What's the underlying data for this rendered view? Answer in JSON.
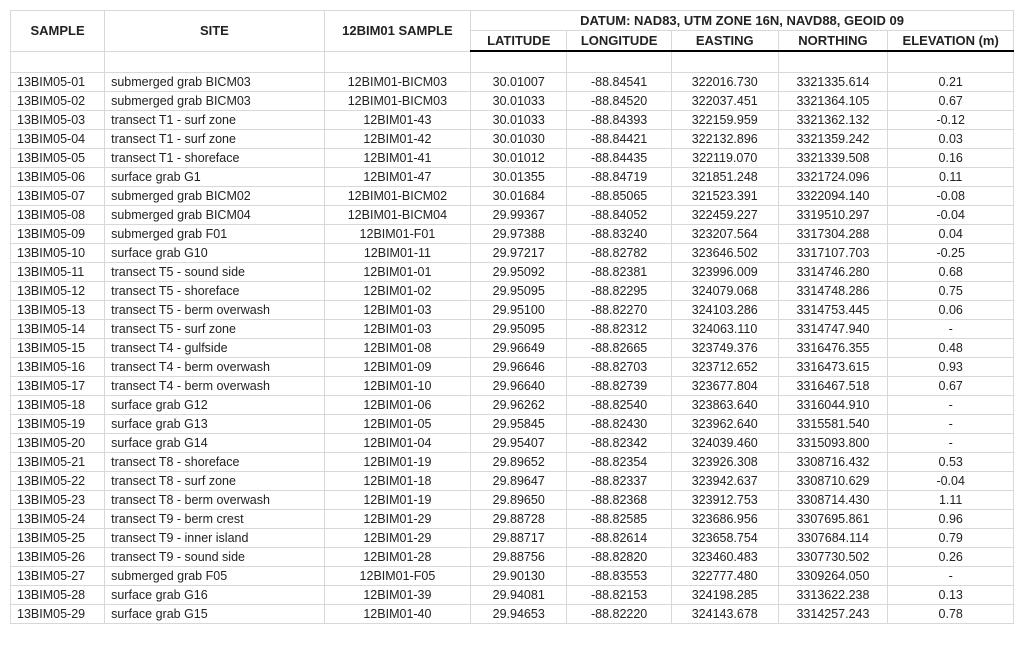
{
  "header": {
    "sample": "SAMPLE",
    "site": "SITE",
    "bim": "12BIM01 SAMPLE",
    "datum_label": "DATUM: NAD83, UTM ZONE 16N, NAVD88, GEOID 09",
    "lat": "LATITUDE",
    "lon": "LONGITUDE",
    "east": "EASTING",
    "north": "NORTHING",
    "elev": "ELEVATION (m)"
  },
  "rows": [
    {
      "sample": "13BIM05-01",
      "site": "submerged grab BICM03",
      "bim": "12BIM01-BICM03",
      "lat": "30.01007",
      "lon": "-88.84541",
      "east": "322016.730",
      "north": "3321335.614",
      "elev": "0.21"
    },
    {
      "sample": "13BIM05-02",
      "site": "submerged grab BICM03",
      "bim": "12BIM01-BICM03",
      "lat": "30.01033",
      "lon": "-88.84520",
      "east": "322037.451",
      "north": "3321364.105",
      "elev": "0.67"
    },
    {
      "sample": "13BIM05-03",
      "site": "transect T1 - surf zone",
      "bim": "12BIM01-43",
      "lat": "30.01033",
      "lon": "-88.84393",
      "east": "322159.959",
      "north": "3321362.132",
      "elev": "-0.12"
    },
    {
      "sample": "13BIM05-04",
      "site": "transect T1 - surf zone",
      "bim": "12BIM01-42",
      "lat": "30.01030",
      "lon": "-88.84421",
      "east": "322132.896",
      "north": "3321359.242",
      "elev": "0.03"
    },
    {
      "sample": "13BIM05-05",
      "site": "transect T1 - shoreface",
      "bim": "12BIM01-41",
      "lat": "30.01012",
      "lon": "-88.84435",
      "east": "322119.070",
      "north": "3321339.508",
      "elev": "0.16"
    },
    {
      "sample": "13BIM05-06",
      "site": "surface grab G1",
      "bim": "12BIM01-47",
      "lat": "30.01355",
      "lon": "-88.84719",
      "east": "321851.248",
      "north": "3321724.096",
      "elev": "0.11"
    },
    {
      "sample": "13BIM05-07",
      "site": "submerged grab BICM02",
      "bim": "12BIM01-BICM02",
      "lat": "30.01684",
      "lon": "-88.85065",
      "east": "321523.391",
      "north": "3322094.140",
      "elev": "-0.08"
    },
    {
      "sample": "13BIM05-08",
      "site": "submerged grab BICM04",
      "bim": "12BIM01-BICM04",
      "lat": "29.99367",
      "lon": "-88.84052",
      "east": "322459.227",
      "north": "3319510.297",
      "elev": "-0.04"
    },
    {
      "sample": "13BIM05-09",
      "site": "submerged grab F01",
      "bim": "12BIM01-F01",
      "lat": "29.97388",
      "lon": "-88.83240",
      "east": "323207.564",
      "north": "3317304.288",
      "elev": "0.04"
    },
    {
      "sample": "13BIM05-10",
      "site": "surface grab G10",
      "bim": "12BIM01-11",
      "lat": "29.97217",
      "lon": "-88.82782",
      "east": "323646.502",
      "north": "3317107.703",
      "elev": "-0.25"
    },
    {
      "sample": "13BIM05-11",
      "site": "transect T5 - sound side",
      "bim": "12BIM01-01",
      "lat": "29.95092",
      "lon": "-88.82381",
      "east": "323996.009",
      "north": "3314746.280",
      "elev": "0.68"
    },
    {
      "sample": "13BIM05-12",
      "site": "transect T5 - shoreface",
      "bim": "12BIM01-02",
      "lat": "29.95095",
      "lon": "-88.82295",
      "east": "324079.068",
      "north": "3314748.286",
      "elev": "0.75"
    },
    {
      "sample": "13BIM05-13",
      "site": "transect T5 - berm overwash",
      "bim": "12BIM01-03",
      "lat": "29.95100",
      "lon": "-88.82270",
      "east": "324103.286",
      "north": "3314753.445",
      "elev": "0.06"
    },
    {
      "sample": "13BIM05-14",
      "site": "transect T5 - surf zone",
      "bim": "12BIM01-03",
      "lat": "29.95095",
      "lon": "-88.82312",
      "east": "324063.110",
      "north": "3314747.940",
      "elev": "-"
    },
    {
      "sample": "13BIM05-15",
      "site": "transect T4 - gulfside",
      "bim": "12BIM01-08",
      "lat": "29.96649",
      "lon": "-88.82665",
      "east": "323749.376",
      "north": "3316476.355",
      "elev": "0.48"
    },
    {
      "sample": "13BIM05-16",
      "site": "transect T4 - berm overwash",
      "bim": "12BIM01-09",
      "lat": "29.96646",
      "lon": "-88.82703",
      "east": "323712.652",
      "north": "3316473.615",
      "elev": "0.93"
    },
    {
      "sample": "13BIM05-17",
      "site": "transect T4 - berm overwash",
      "bim": "12BIM01-10",
      "lat": "29.96640",
      "lon": "-88.82739",
      "east": "323677.804",
      "north": "3316467.518",
      "elev": "0.67"
    },
    {
      "sample": "13BIM05-18",
      "site": "surface grab G12",
      "bim": "12BIM01-06",
      "lat": "29.96262",
      "lon": "-88.82540",
      "east": "323863.640",
      "north": "3316044.910",
      "elev": "-"
    },
    {
      "sample": "13BIM05-19",
      "site": "surface grab G13",
      "bim": "12BIM01-05",
      "lat": "29.95845",
      "lon": "-88.82430",
      "east": "323962.640",
      "north": "3315581.540",
      "elev": "-"
    },
    {
      "sample": "13BIM05-20",
      "site": "surface grab G14",
      "bim": "12BIM01-04",
      "lat": "29.95407",
      "lon": "-88.82342",
      "east": "324039.460",
      "north": "3315093.800",
      "elev": "-"
    },
    {
      "sample": "13BIM05-21",
      "site": "transect T8 - shoreface",
      "bim": "12BIM01-19",
      "lat": "29.89652",
      "lon": "-88.82354",
      "east": "323926.308",
      "north": "3308716.432",
      "elev": "0.53"
    },
    {
      "sample": "13BIM05-22",
      "site": "transect T8 - surf zone",
      "bim": "12BIM01-18",
      "lat": "29.89647",
      "lon": "-88.82337",
      "east": "323942.637",
      "north": "3308710.629",
      "elev": "-0.04"
    },
    {
      "sample": "13BIM05-23",
      "site": "transect T8 - berm overwash",
      "bim": "12BIM01-19",
      "lat": "29.89650",
      "lon": "-88.82368",
      "east": "323912.753",
      "north": "3308714.430",
      "elev": "1.11"
    },
    {
      "sample": "13BIM05-24",
      "site": "transect T9 - berm crest",
      "bim": "12BIM01-29",
      "lat": "29.88728",
      "lon": "-88.82585",
      "east": "323686.956",
      "north": "3307695.861",
      "elev": "0.96"
    },
    {
      "sample": "13BIM05-25",
      "site": "transect T9 - inner island",
      "bim": "12BIM01-29",
      "lat": "29.88717",
      "lon": "-88.82614",
      "east": "323658.754",
      "north": "3307684.114",
      "elev": "0.79"
    },
    {
      "sample": "13BIM05-26",
      "site": "transect T9 - sound side",
      "bim": "12BIM01-28",
      "lat": "29.88756",
      "lon": "-88.82820",
      "east": "323460.483",
      "north": "3307730.502",
      "elev": "0.26"
    },
    {
      "sample": "13BIM05-27",
      "site": "submerged grab  F05",
      "bim": "12BIM01-F05",
      "lat": "29.90130",
      "lon": "-88.83553",
      "east": "322777.480",
      "north": "3309264.050",
      "elev": "-"
    },
    {
      "sample": "13BIM05-28",
      "site": "surface grab G16",
      "bim": "12BIM01-39",
      "lat": "29.94081",
      "lon": "-88.82153",
      "east": "324198.285",
      "north": "3313622.238",
      "elev": "0.13"
    },
    {
      "sample": "13BIM05-29",
      "site": "surface grab G15",
      "bim": "12BIM01-40",
      "lat": "29.94653",
      "lon": "-88.82220",
      "east": "324143.678",
      "north": "3314257.243",
      "elev": "0.78"
    }
  ]
}
